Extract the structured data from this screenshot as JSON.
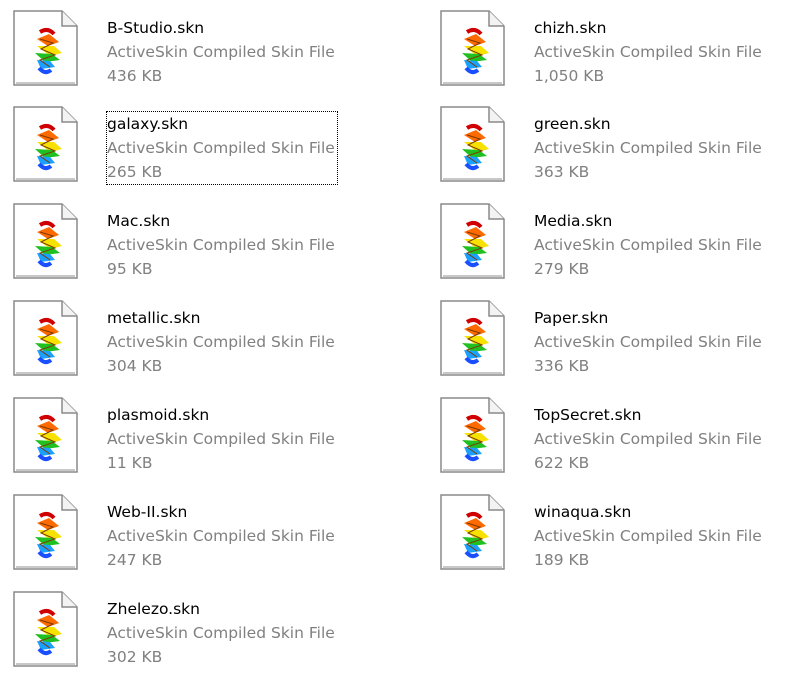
{
  "files": [
    {
      "name": "B-Studio.skn",
      "type": "ActiveSkin Compiled Skin File",
      "size": "436 KB",
      "icon": "skin-file-icon",
      "focused": false
    },
    {
      "name": "chizh.skn",
      "type": "ActiveSkin Compiled Skin File",
      "size": "1,050 KB",
      "icon": "skin-file-icon",
      "focused": false
    },
    {
      "name": "galaxy.skn",
      "type": "ActiveSkin Compiled Skin File",
      "size": "265 KB",
      "icon": "skin-file-icon",
      "focused": true
    },
    {
      "name": "green.skn",
      "type": "ActiveSkin Compiled Skin File",
      "size": "363 KB",
      "icon": "skin-file-icon",
      "focused": false
    },
    {
      "name": "Mac.skn",
      "type": "ActiveSkin Compiled Skin File",
      "size": "95 KB",
      "icon": "skin-file-icon",
      "focused": false
    },
    {
      "name": "Media.skn",
      "type": "ActiveSkin Compiled Skin File",
      "size": "279 KB",
      "icon": "skin-file-icon",
      "focused": false
    },
    {
      "name": "metallic.skn",
      "type": "ActiveSkin Compiled Skin File",
      "size": "304 KB",
      "icon": "skin-file-icon",
      "focused": false
    },
    {
      "name": "Paper.skn",
      "type": "ActiveSkin Compiled Skin File",
      "size": "336 KB",
      "icon": "skin-file-icon",
      "focused": false
    },
    {
      "name": "plasmoid.skn",
      "type": "ActiveSkin Compiled Skin File",
      "size": "11 KB",
      "icon": "skin-file-icon",
      "focused": false
    },
    {
      "name": "TopSecret.skn",
      "type": "ActiveSkin Compiled Skin File",
      "size": "622 KB",
      "icon": "skin-file-icon",
      "focused": false
    },
    {
      "name": "Web-II.skn",
      "type": "ActiveSkin Compiled Skin File",
      "size": "247 KB",
      "icon": "skin-file-icon",
      "focused": false
    },
    {
      "name": "winaqua.skn",
      "type": "ActiveSkin Compiled Skin File",
      "size": "189 KB",
      "icon": "skin-file-icon",
      "focused": false
    },
    {
      "name": "Zhelezo.skn",
      "type": "ActiveSkin Compiled Skin File",
      "size": "302 KB",
      "icon": "skin-file-icon",
      "focused": false
    }
  ],
  "colors": {
    "name_text": "#000000",
    "detail_text": "#808080",
    "background": "#ffffff"
  }
}
